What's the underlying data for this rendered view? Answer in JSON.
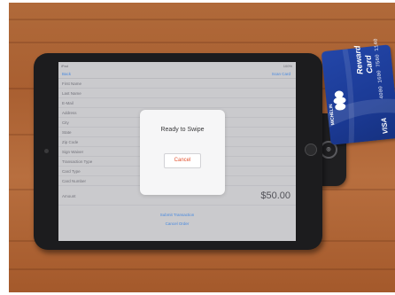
{
  "app": {
    "status_left": "iPad",
    "status_right": "100%",
    "nav_back": "Back",
    "nav_action": "Scan Card"
  },
  "form": {
    "rows": [
      {
        "label": "First Name",
        "value": ""
      },
      {
        "label": "Last Name",
        "value": ""
      },
      {
        "label": "E-Mail",
        "value": ""
      },
      {
        "label": "Address",
        "value": ""
      },
      {
        "label": "City",
        "value": ""
      },
      {
        "label": "State",
        "value": ""
      },
      {
        "label": "Zip Code",
        "value": ""
      },
      {
        "label": "Sign Waiver",
        "value": ""
      },
      {
        "label": "Transaction Type",
        "value": ""
      },
      {
        "label": "Card Type",
        "value": ""
      },
      {
        "label": "Card Number",
        "value": ""
      },
      {
        "label": "Amount",
        "value": "$50.00"
      }
    ]
  },
  "links": {
    "primary": "Submit Transaction",
    "secondary": "Cancel Order"
  },
  "dialog": {
    "title": "Ready to Swipe",
    "cancel_label": "Cancel"
  },
  "card": {
    "title_line1": "Reward",
    "title_line2": "Card",
    "number": "4000 1600 7560 1140",
    "brand": "VISA",
    "issuer": "MICHELIN",
    "colors": {
      "card": "#1f3f9e",
      "accent": "#ffffff"
    }
  },
  "reader": {
    "logo": "icon-reader-logo"
  }
}
